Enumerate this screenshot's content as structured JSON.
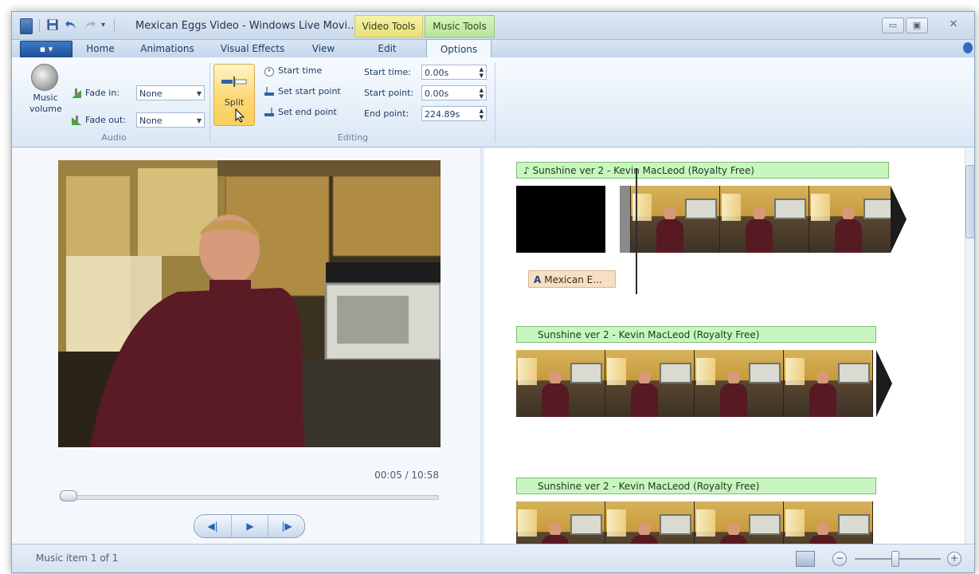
{
  "window": {
    "title": "Mexican Eggs Video - Windows Live Movi...",
    "context_tabs": [
      "Video Tools",
      "Music Tools"
    ],
    "controls": {
      "minimize": "▭",
      "maximize": "▣",
      "close": "✕"
    }
  },
  "quick_access": {
    "save_icon": "floppy-disk",
    "undo_icon": "undo",
    "redo_icon": "redo",
    "more_icon": "▾"
  },
  "tabs": {
    "app_menu": "▪ ▾",
    "items": [
      "Home",
      "Animations",
      "Visual Effects",
      "View",
      "Edit",
      "Options"
    ],
    "active": "Options"
  },
  "ribbon": {
    "audio": {
      "group_label": "Audio",
      "music_volume": "Music volume",
      "fade_in_label": "Fade in:",
      "fade_in_value": "None",
      "fade_out_label": "Fade out:",
      "fade_out_value": "None"
    },
    "editing": {
      "group_label": "Editing",
      "split_label": "Split",
      "start_time_button": "Start time",
      "set_start_point": "Set start point",
      "set_end_point": "Set end point",
      "start_time_label": "Start time:",
      "start_time_value": "0.00s",
      "start_point_label": "Start point:",
      "start_point_value": "0.00s",
      "end_point_label": "End point:",
      "end_point_value": "224.89s"
    }
  },
  "preview": {
    "time": "00:05 / 10:58",
    "controls": {
      "prev": "◀|",
      "play": "▶",
      "next": "|▶"
    }
  },
  "storyboard": {
    "music_tracks": [
      "Sunshine ver 2 - Kevin MacLeod (Royalty Free)",
      "Sunshine ver 2 - Kevin MacLeod (Royalty Free)",
      "Sunshine ver 2 - Kevin MacLeod (Royalty Free)"
    ],
    "music_note": "♪",
    "caption_glyph": "A",
    "caption_text": "Mexican E..."
  },
  "status": {
    "text": "Music item 1 of 1",
    "zoom_minus": "−",
    "zoom_plus": "+",
    "zoom_level": 0.5
  },
  "colors": {
    "music_bar": "#c8f5c0",
    "video_tools": "#f7f3a8",
    "music_tools": "#d9f5c0",
    "split_button": "#fcd773"
  }
}
